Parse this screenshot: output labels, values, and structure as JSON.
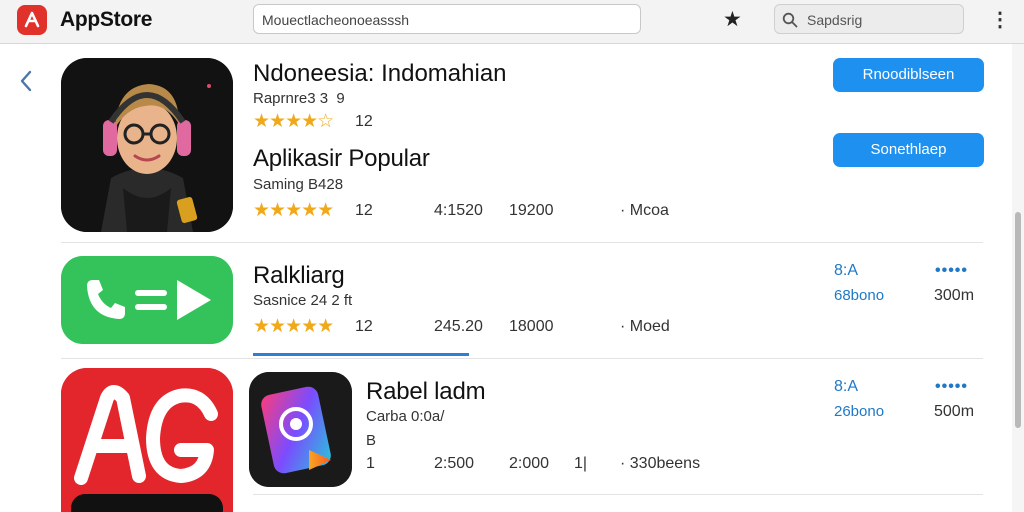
{
  "topbar": {
    "app_title": "AppStore",
    "address": "Mouectlacheonoeasssh",
    "search_placeholder": "Sapdsrig"
  },
  "listing1": {
    "title": "Ndoneesia: Indomahian",
    "meta": "Raprnre3 3  9",
    "stars": "★★★★☆",
    "rating": "12",
    "button1": "Rnoodiblseen",
    "button2": "Sonethlaep"
  },
  "section": {
    "heading": "Aplikasir Popular",
    "meta": "Saming B428",
    "stars": "★★★★★",
    "rating": "12",
    "col1": "4:1520",
    "col2": "19200",
    "col3": "· Mcoa"
  },
  "app2": {
    "title": "Ralkliarg",
    "meta": "Sasnice 24 2 ft",
    "stars": "★★★★★",
    "rating": "12",
    "col1": "245.20",
    "col2": "18000",
    "col3": "· Moed",
    "right_top": "8:A",
    "right_bottom": "68bono",
    "dots": "•••••",
    "size": "300m"
  },
  "app3": {
    "title": "Rabel ladm",
    "meta": "Carba 0:0a/",
    "meta2": "B",
    "col0": "1",
    "col1": "2:500",
    "col2": "2:000",
    "col_mid": "1|",
    "col3": "· 330beens",
    "right_top": "8:A",
    "right_bottom": "26bono",
    "dots": "•••••",
    "size": "500m"
  },
  "colors": {
    "accent": "#1e90f0",
    "star": "#f0a91a",
    "link": "#1f78c8",
    "logo": "#e0312b"
  },
  "icons": [
    "logo-icon",
    "star-icon",
    "search-icon",
    "more-vertical-icon",
    "chevron-left-icon",
    "avatar-app-icon",
    "play-arrow-app-icon",
    "ag-letters-app-icon",
    "camera-gradient-app-icon"
  ]
}
